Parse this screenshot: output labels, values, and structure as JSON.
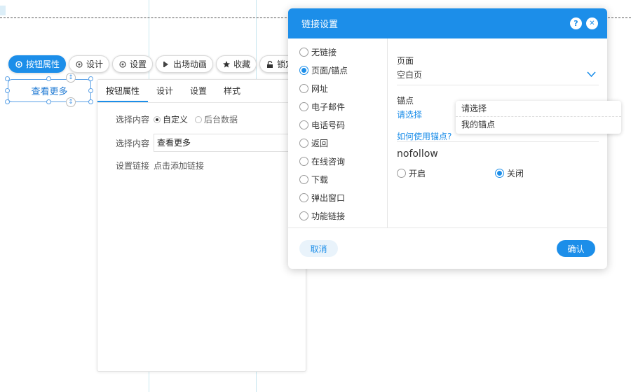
{
  "toolbar": {
    "items": [
      {
        "label": "按钮属性",
        "icon": "gear-icon",
        "active": true
      },
      {
        "label": "设计",
        "icon": "gear-icon"
      },
      {
        "label": "设置",
        "icon": "gear-icon"
      },
      {
        "label": "出场动画",
        "icon": "animation-icon"
      },
      {
        "label": "收藏",
        "icon": "star-icon"
      },
      {
        "label": "锁定",
        "icon": "lock-icon"
      }
    ]
  },
  "canvas": {
    "button_text": "查看更多"
  },
  "panel": {
    "tabs": [
      "按钮属性",
      "设计",
      "设置",
      "样式"
    ],
    "content_label": "选择内容",
    "radio_custom": "自定义",
    "radio_backend": "后台数据",
    "content_label2": "选择内容",
    "content_value": "查看更多",
    "link_label": "设置链接",
    "link_value": "点击添加链接"
  },
  "dialog": {
    "title": "链接设置",
    "help": "?",
    "close": "✕",
    "options": [
      "无链接",
      "页面/锚点",
      "网址",
      "电子邮件",
      "电话号码",
      "返回",
      "在线咨询",
      "下载",
      "弹出窗口",
      "功能链接"
    ],
    "selected_index": 1,
    "page_label": "页面",
    "page_value": "空白页",
    "anchor_label": "锚点",
    "anchor_value": "请选择",
    "anchor_help": "如何使用锚点?",
    "nofollow_label": "nofollow",
    "nofollow_on": "开启",
    "nofollow_off": "关闭",
    "cancel": "取消",
    "confirm": "确认"
  },
  "anchor_dropdown": [
    "请选择",
    "我的锚点"
  ],
  "colors": {
    "accent": "#1c8ee9"
  }
}
